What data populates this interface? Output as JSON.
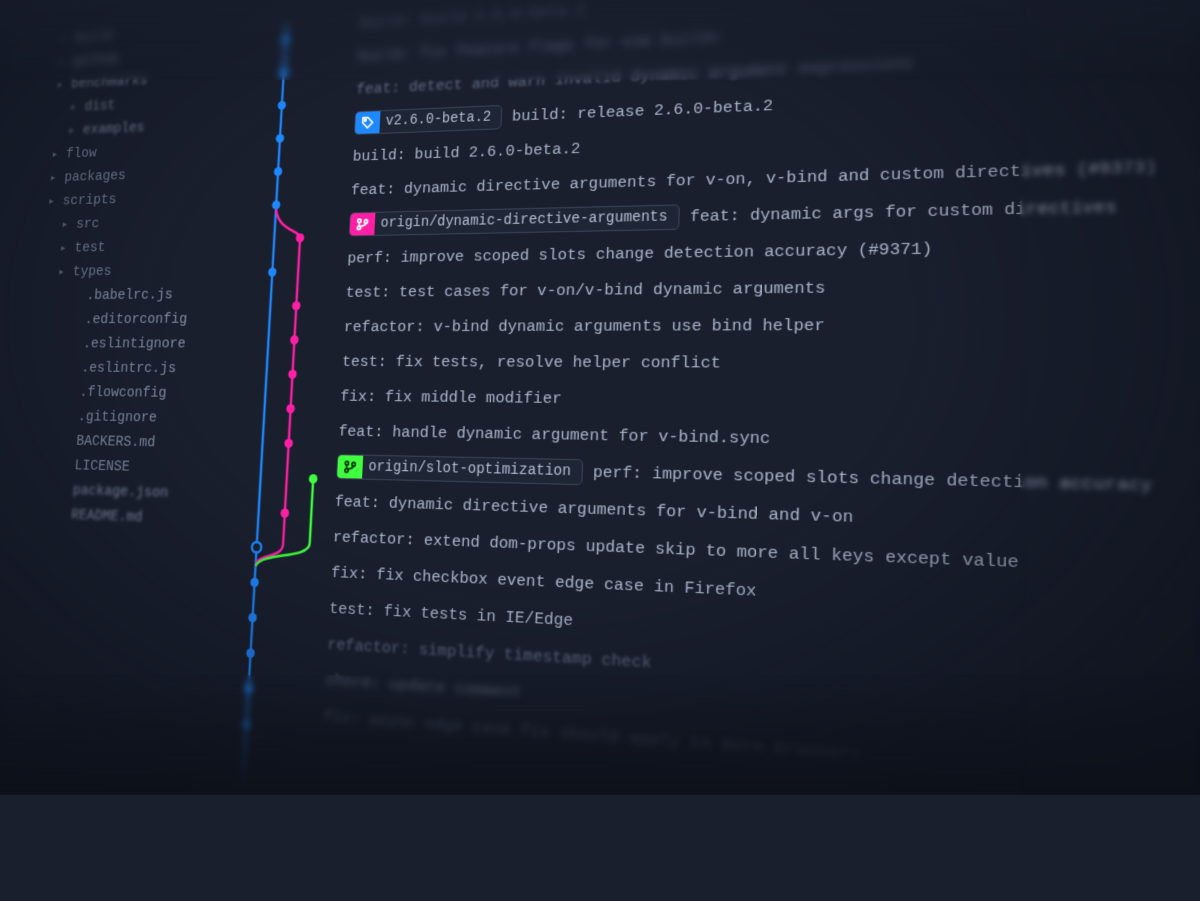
{
  "colors": {
    "lane_blue": "#1e88ff",
    "lane_pink": "#ff1fa5",
    "lane_green": "#3fff3f"
  },
  "sidebar": {
    "items": [
      {
        "label": "build",
        "kind": "folder",
        "indent": 0,
        "blur": true
      },
      {
        "label": "github",
        "kind": "folder",
        "indent": 0,
        "blur": true
      },
      {
        "label": "benchmarks",
        "kind": "folder",
        "indent": 0,
        "blur": true
      },
      {
        "label": "dist",
        "kind": "folder",
        "indent": 1,
        "blur": true
      },
      {
        "label": "examples",
        "kind": "folder",
        "indent": 1,
        "blur": true
      },
      {
        "label": "flow",
        "kind": "folder",
        "indent": 0
      },
      {
        "label": "packages",
        "kind": "folder",
        "indent": 0
      },
      {
        "label": "scripts",
        "kind": "folder",
        "indent": 0
      },
      {
        "label": "src",
        "kind": "folder",
        "indent": 1
      },
      {
        "label": "test",
        "kind": "folder",
        "indent": 1
      },
      {
        "label": "types",
        "kind": "folder",
        "indent": 1
      },
      {
        "label": ".babelrc.js",
        "kind": "file",
        "indent": 2
      },
      {
        "label": ".editorconfig",
        "kind": "file",
        "indent": 2
      },
      {
        "label": ".eslintignore",
        "kind": "file",
        "indent": 2
      },
      {
        "label": ".eslintrc.js",
        "kind": "file",
        "indent": 2
      },
      {
        "label": ".flowconfig",
        "kind": "file",
        "indent": 2
      },
      {
        "label": ".gitignore",
        "kind": "file",
        "indent": 2
      },
      {
        "label": "BACKERS.md",
        "kind": "file",
        "indent": 2
      },
      {
        "label": "LICENSE",
        "kind": "file",
        "indent": 2
      },
      {
        "label": "package.json",
        "kind": "file",
        "indent": 2,
        "blur": true
      },
      {
        "label": "README.md",
        "kind": "file",
        "indent": 2,
        "blur": true
      }
    ]
  },
  "commits": [
    {
      "lane": 0,
      "message": "build: build 2.6.0-beta.1",
      "dim": true
    },
    {
      "lane": 0,
      "message": "build: fix feature flags for esm builds",
      "dim": true
    },
    {
      "lane": 0,
      "message": "feat: detect and warn invalid dynamic argument expressions",
      "dim": true
    },
    {
      "lane": 0,
      "tag": {
        "label": "v2.6.0-beta.2",
        "color": "blue",
        "icon": "tag"
      },
      "message": "build: release 2.6.0-beta.2"
    },
    {
      "lane": 0,
      "message": "build: build 2.6.0-beta.2"
    },
    {
      "lane": 0,
      "message": "feat: dynamic directive arguments for v-on, v-bind and custom directives (#9373)"
    },
    {
      "lane": 1,
      "tag": {
        "label": "origin/dynamic-directive-arguments",
        "color": "pink",
        "icon": "branch"
      },
      "message": "feat: dynamic args for custom directives"
    },
    {
      "lane": 0,
      "message": "perf: improve scoped slots change detection accuracy (#9371)"
    },
    {
      "lane": 1,
      "message": "test: test cases for v-on/v-bind dynamic arguments"
    },
    {
      "lane": 1,
      "message": "refactor: v-bind dynamic arguments use bind helper"
    },
    {
      "lane": 1,
      "message": "test: fix tests, resolve helper conflict"
    },
    {
      "lane": 1,
      "message": "fix: fix middle modifier"
    },
    {
      "lane": 1,
      "message": "feat: handle dynamic argument for v-bind.sync"
    },
    {
      "lane": 2,
      "tag": {
        "label": "origin/slot-optimization",
        "color": "green",
        "icon": "branch"
      },
      "message": "perf: improve scoped slots change detection accuracy"
    },
    {
      "lane": 1,
      "message": "feat: dynamic directive arguments for v-bind and v-on"
    },
    {
      "lane": 0,
      "merge": true,
      "message": "refactor: extend dom-props update skip to more all keys except value"
    },
    {
      "lane": 0,
      "message": "fix: fix checkbox event edge case in Firefox"
    },
    {
      "lane": 0,
      "message": "test: fix tests in IE/Edge"
    },
    {
      "lane": 0,
      "message": "refactor: simplify timestamp check",
      "dim": true
    },
    {
      "lane": 0,
      "message": "chore: update comment",
      "dim": true
    },
    {
      "lane": 0,
      "message": "fix: async edge case fix should apply to more browsers",
      "dim": true
    }
  ]
}
